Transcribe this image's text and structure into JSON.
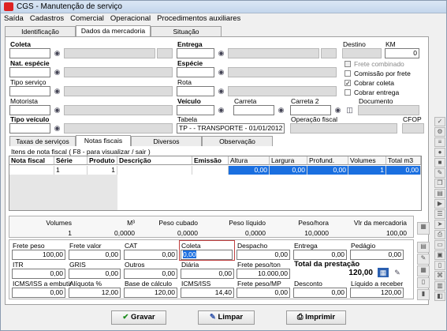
{
  "window": {
    "title": "CGS - Manutenção de serviço"
  },
  "menu": [
    "Saída",
    "Cadastros",
    "Comercial",
    "Operacional",
    "Procedimentos auxiliares"
  ],
  "tabs": [
    "Identificação",
    "Dados da mercadoria",
    "Situação"
  ],
  "form": {
    "coleta": "Coleta",
    "entrega": "Entrega",
    "destino": "Destino",
    "km": "KM",
    "km_value": "0",
    "nat_especie": "Nat. espécie",
    "especie": "Espécie",
    "frete_combinado": "Frete combinado",
    "comissao_por_frete": "Comissão por frete",
    "cobrar_coleta": "Cobrar coleta",
    "cobrar_entrega": "Cobrar entrega",
    "tipo_servico": "Tipo serviço",
    "rota": "Rota",
    "motorista": "Motorista",
    "veiculo": "Veículo",
    "carreta": "Carreta",
    "carreta2": "Carreta 2",
    "documento": "Documento",
    "tipo_veiculo": "Tipo veículo",
    "tabela": "Tabela",
    "tabela_value": "TP - - TRANSPORTE - 01/01/2012",
    "operacao_fiscal": "Operação fiscal",
    "cfop": "CFOP"
  },
  "subtabs": [
    "Taxas de serviços",
    "Notas fiscais",
    "Diversos",
    "Observação"
  ],
  "grid": {
    "caption": "Itens de nota fiscal ( F8 - para visualizar / sair )",
    "headers": [
      "Nota fiscal",
      "Série",
      "Produto",
      "Descrição",
      "Emissão",
      "Altura",
      "Largura",
      "Profund.",
      "Volumes",
      "Total m3"
    ],
    "row": [
      "",
      "1",
      "1",
      "",
      "",
      "0,00",
      "0,00",
      "0,00",
      "1",
      "0,00"
    ]
  },
  "totals": {
    "labels": [
      "Volumes",
      "M³",
      "Peso cubado",
      "Peso líquido",
      "Peso/hora",
      "Vlr da mercadoria"
    ],
    "values": [
      "1",
      "0,0000",
      "0,0000",
      "0,0000",
      "10,0000",
      "100,00"
    ]
  },
  "calc": {
    "frete_peso": "Frete peso",
    "frete_peso_v": "100,00",
    "frete_valor": "Frete valor",
    "frete_valor_v": "0,00",
    "cat": "CAT",
    "cat_v": "0,00",
    "coleta": "Coleta",
    "coleta_v": "0,00",
    "despacho": "Despacho",
    "despacho_v": "0,00",
    "entrega": "Entrega",
    "entrega_v": "0,00",
    "pedagio": "Pedágio",
    "pedagio_v": "0,00",
    "itr": "ITR",
    "itr_v": "0,00",
    "gris": "GRIS",
    "gris_v": "0,00",
    "outros": "Outros",
    "outros_v": "0,00",
    "diaria": "Diária",
    "diaria_v": "0,00",
    "frete_peso_ton": "Frete peso/ton",
    "frete_peso_ton_v": "10.000,00",
    "total_prestacao": "Total da prestação",
    "total_prestacao_v": "120,00",
    "icms_embutir": "ICMS/ISS a embutir",
    "icms_embutir_v": "0,00",
    "aliquota": "Alíquota %",
    "aliquota_v": "12,00",
    "base_calculo": "Base de cálculo",
    "base_calculo_v": "120,00",
    "icms_iss": "ICMS/ISS",
    "icms_iss_v": "14,40",
    "frete_peso_mp": "Frete peso/MP",
    "frete_peso_mp_v": "0,00",
    "desconto": "Desconto",
    "desconto_v": "0,00",
    "liquido": "Líquido a receber",
    "liquido_v": "120,00"
  },
  "buttons": {
    "gravar": "Gravar",
    "limpar": "Limpar",
    "imprimir": "Imprimir"
  }
}
